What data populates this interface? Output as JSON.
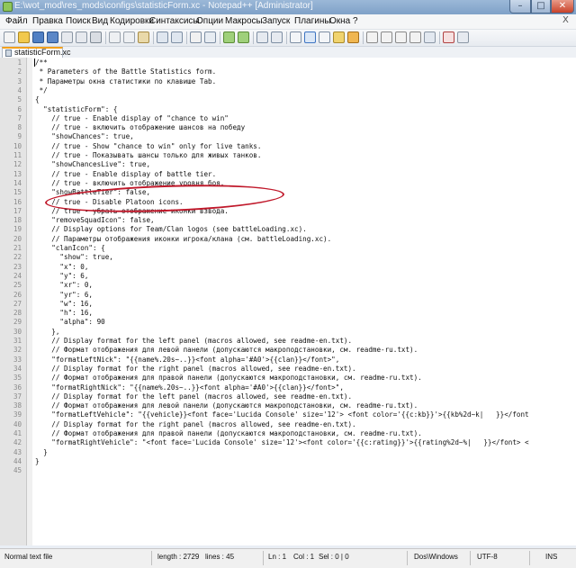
{
  "window": {
    "title": "E:\\wot_mod\\res_mods\\configs\\statisticForm.xc - Notepad++ [Administrator]",
    "icon": "notepad-plus-plus-icon"
  },
  "menu": [
    "Файл",
    "Правка",
    "Поиск",
    "Вид",
    "Кодировки",
    "Синтаксисы",
    "Опции",
    "Макросы",
    "Запуск",
    "Плагины",
    "Окна",
    "?"
  ],
  "menu_close": "X",
  "tab": {
    "label": "statisticForm.xc",
    "icon": "file-icon"
  },
  "editor": {
    "lines": [
      "/**",
      " * Parameters of the Battle Statistics form.",
      " * Параметры окна статистики по клавише Tab.",
      " */",
      "{",
      "  \"statisticForm\": {",
      "    // true - Enable display of \"chance to win\"",
      "    // true - включить отображение шансов на победу",
      "    \"showChances\": true,",
      "    // true - Show \"chance to win\" only for live tanks.",
      "    // true - Показывать шансы только для живых танков.",
      "    \"showChancesLive\": true,",
      "    // true - Enable display of battle tier.",
      "    // true - включить отображение уровня боя.",
      "    \"showBattleTier\": false,",
      "    // true - Disable Platoon icons.",
      "    // true - убрать отображение иконки взвода.",
      "    \"removeSquadIcon\": false,",
      "    // Display options for Team/Clan logos (see battleLoading.xc).",
      "    // Параметры отображения иконки игрока/клана (см. battleLoading.xc).",
      "    \"clanIcon\": {",
      "      \"show\": true,",
      "      \"x\": 0,",
      "      \"y\": 6,",
      "      \"xr\": 0,",
      "      \"yr\": 6,",
      "      \"w\": 16,",
      "      \"h\": 16,",
      "      \"alpha\": 90",
      "    },",
      "    // Display format for the left panel (macros allowed, see readme-en.txt).",
      "    // Формат отображения для левой панели (допускаются макроподстановки, см. readme-ru.txt).",
      "    \"formatLeftNick\": \"{{name%.20s~..}}<font alpha='#A0'>{{clan}}</font>\",",
      "    // Display format for the right panel (macros allowed, see readme-en.txt).",
      "    // Формат отображения для правой панели (допускаются макроподстановки, см. readme-ru.txt).",
      "    \"formatRightNick\": \"{{name%.20s~..}}<font alpha='#A0'>{{clan}}</font>\",",
      "    // Display format for the left panel (macros allowed, see readme-en.txt).",
      "    // Формат отображения для левой панели (допускаются макроподстановки, см. readme-ru.txt).",
      "    \"formatLeftVehicle\": \"{{vehicle}}<font face='Lucida Console' size='12'> <font color='{{c:kb}}'>{{kb%2d~k|   }}</font",
      "    // Display format for the right panel (macros allowed, see readme-en.txt).",
      "    // Формат отображения для правой панели (допускаются макроподстановки, см. readme-ru.txt).",
      "    \"formatRightVehicle\": \"<font face='Lucida Console' size='12'><font color='{{c:rating}}'>{{rating%2d~%|   }}</font> <",
      "  }",
      "}",
      ""
    ]
  },
  "statusbar": {
    "filetype": "Normal text file",
    "length": "length : 2729",
    "lines": "lines : 45",
    "ln": "Ln : 1",
    "col": "Col : 1",
    "sel": "Sel : 0 | 0",
    "eol": "Dos\\Windows",
    "encoding": "UTF-8",
    "mode": "INS"
  },
  "colors": {
    "title_bar": "#8fadd2",
    "annotation_oval": "#c0182a",
    "tab_accent": "#f3a01b"
  }
}
